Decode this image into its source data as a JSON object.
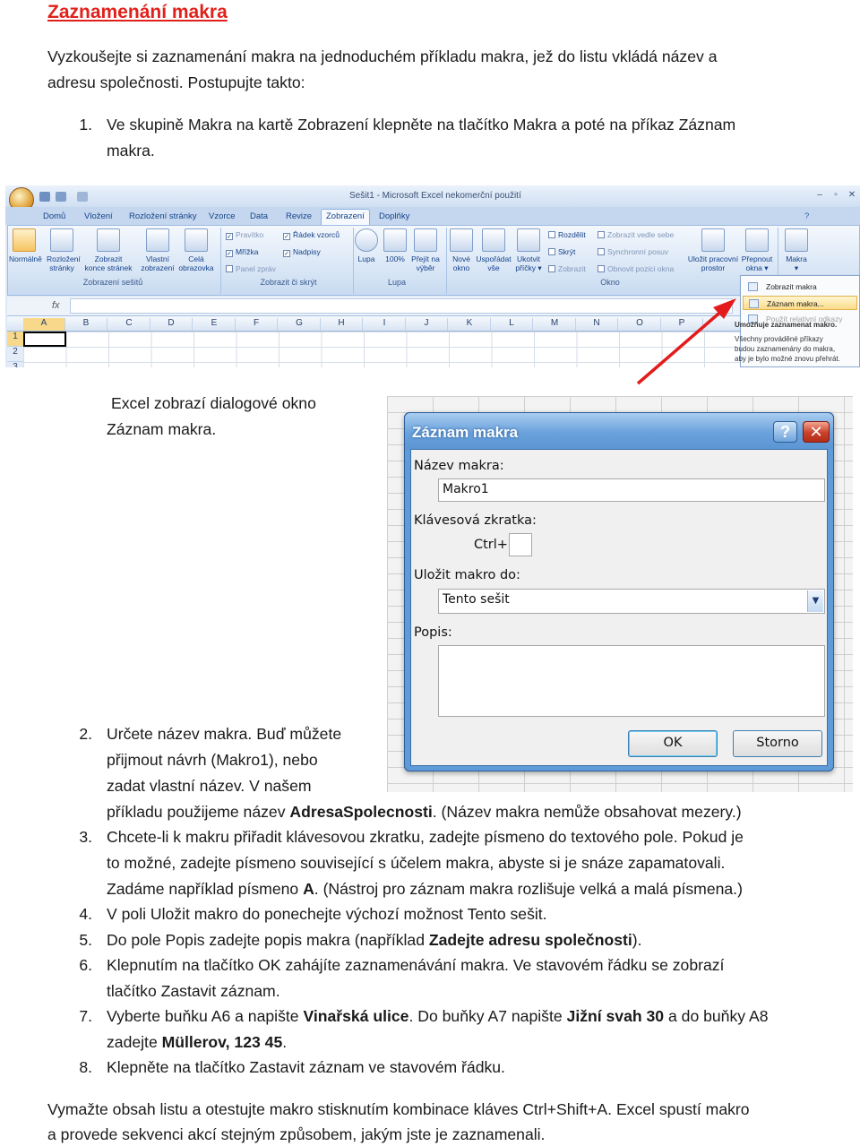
{
  "title": "Zaznamenání makra",
  "intro": [
    "Vyzkoušejte si zaznamenání makra na jednoduchém příkladu makra, jež do listu vkládá název a",
    "adresu společnosti. Postupujte takto:"
  ],
  "step1": {
    "num": "1.",
    "lines": [
      "Ve skupině Makra na kartě Zobrazení klepněte na tlačítko Makra a poté na příkaz Záznam",
      "makra."
    ]
  },
  "excel_screenshot": {
    "window_title": "Sešit1 - Microsoft Excel nekomerční použití",
    "tabs": [
      "Domů",
      "Vložení",
      "Rozložení stránky",
      "Vzorce",
      "Data",
      "Revize",
      "Zobrazení",
      "Doplňky"
    ],
    "active_tab": "Zobrazení",
    "big_buttons": [
      {
        "l1": "Normálně",
        "l2": ""
      },
      {
        "l1": "Rozložení",
        "l2": "stránky"
      },
      {
        "l1": "Zobrazit",
        "l2": "konce stránek"
      },
      {
        "l1": "Vlastní",
        "l2": "zobrazení"
      },
      {
        "l1": "Celá",
        "l2": "obrazovka"
      },
      {
        "l1": "Lupa",
        "l2": ""
      },
      {
        "l1": "100%",
        "l2": ""
      },
      {
        "l1": "Přejít na",
        "l2": "výběr"
      },
      {
        "l1": "Nové",
        "l2": "okno"
      },
      {
        "l1": "Uspořádat",
        "l2": "vše"
      },
      {
        "l1": "Ukotvit",
        "l2": "příčky ▾"
      },
      {
        "l1": "Uložit pracovní",
        "l2": "prostor"
      },
      {
        "l1": "Přepnout",
        "l2": "okna ▾"
      },
      {
        "l1": "Makra",
        "l2": "▾"
      }
    ],
    "checks": [
      "Pravítko",
      "Řádek vzorců",
      "Mřížka",
      "Nadpisy",
      "Panel zpráv"
    ],
    "window_small": [
      "Rozdělit",
      "Skrýt",
      "Zobrazit",
      "Zobrazit vedle sebe",
      "Synchronní posuv",
      "Obnovit pozici okna"
    ],
    "group_labels": [
      "Zobrazení sešitů",
      "Zobrazit či skrýt",
      "Lupa",
      "Okno"
    ],
    "fx": "fx",
    "columns": [
      "A",
      "B",
      "C",
      "D",
      "E",
      "F",
      "G",
      "H",
      "I",
      "J",
      "K",
      "L",
      "M",
      "N",
      "O",
      "P"
    ],
    "rows": [
      "1",
      "2",
      "3"
    ],
    "menu": [
      "Zobrazit makra",
      "Záznam makra...",
      "Použít relativní odkazy"
    ],
    "tooltip_title": "Umožňuje zaznamenat makro.",
    "tooltip_lines": [
      "Všechny prováděné příkazy",
      "budou zaznamenány do makra,",
      "aby je bylo možné znovu přehrát."
    ]
  },
  "excel_caption": [
    "Excel zobrazí dialogové okno",
    "Záznam makra."
  ],
  "dialog": {
    "title": "Záznam makra",
    "help": "?",
    "close": "✕",
    "name_label": "Název makra:",
    "name_value": "Makro1",
    "shortcut_label": "Klávesová zkratka:",
    "ctrl": "Ctrl+",
    "store_label": "Uložit makro do:",
    "store_value": "Tento sešit",
    "desc_label": "Popis:",
    "ok": "OK",
    "cancel": "Storno"
  },
  "step2": {
    "num": "2.",
    "l1": "Určete název makra. Buď můžete",
    "l2": "přijmout návrh (Makro1), nebo",
    "l3": "zadat vlastní název. V našem",
    "l4a": "příkladu použijeme název ",
    "l4b": "AdresaSpolecnosti",
    "l4c": ". (Název makra nemůže obsahovat mezery.)"
  },
  "step3": {
    "num": "3.",
    "l1": "Chcete-li k makru přiřadit klávesovou zkratku, zadejte písmeno do textového pole. Pokud je",
    "l2": "to možné, zadejte písmeno související s účelem makra, abyste si je snáze zapamatovali.",
    "l3a": "Zadáme například písmeno ",
    "l3b": "A",
    "l3c": ". (Nástroj pro záznam makra rozlišuje velká a malá písmena.)"
  },
  "step4": {
    "num": "4.",
    "l1": "V poli Uložit makro do ponechejte výchozí možnost Tento sešit."
  },
  "step5": {
    "num": "5.",
    "a": "Do pole Popis zadejte popis makra (například ",
    "b": "Zadejte adresu společnosti",
    "c": ")."
  },
  "step6": {
    "num": "6.",
    "l1": "Klepnutím na tlačítko OK zahájíte zaznamenávání makra. Ve stavovém řádku se zobrazí",
    "l2": "tlačítko Zastavit záznam."
  },
  "step7": {
    "num": "7.",
    "a": "Vyberte buňku A6 a napište ",
    "b": "Vinařská ulice",
    "c": ". Do buňky A7 napište ",
    "d": "Jižní svah 30",
    "e": " a do buňky A8",
    "f": "zadejte ",
    "g": "Müllerov, 123 45",
    "h": "."
  },
  "step8": {
    "num": "8.",
    "l1": "Klepněte na tlačítko Zastavit záznam ve stavovém řádku."
  },
  "outro": [
    "Vymažte obsah listu a otestujte makro stisknutím kombinace kláves Ctrl+Shift+A. Excel spustí makro",
    "a provede sekvenci akcí stejným způsobem, jakým jste je zaznamenali."
  ]
}
